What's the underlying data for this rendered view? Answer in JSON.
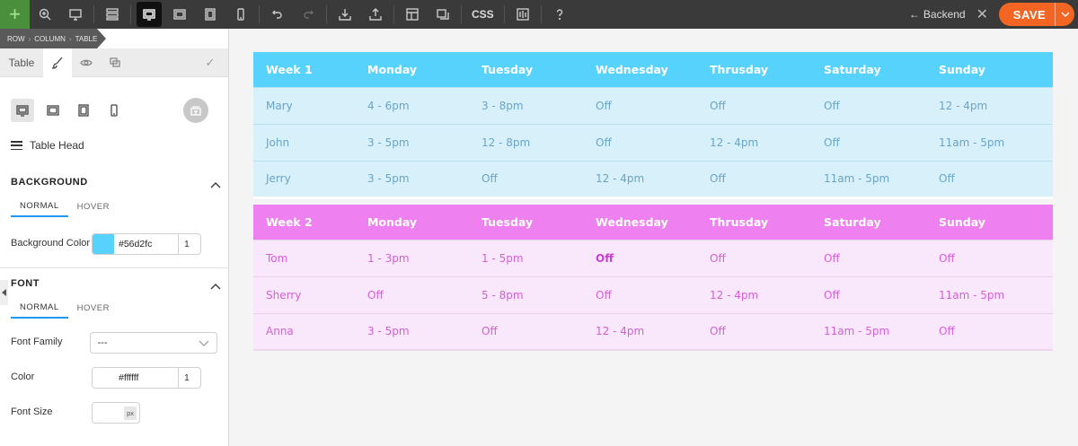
{
  "toolbar": {
    "css_label": "CSS",
    "backend_label": "Backend",
    "save_label": "SAVE"
  },
  "breadcrumb": [
    "ROW",
    "COLUMN",
    "TABLE"
  ],
  "panel": {
    "tabs": {
      "table_label": "Table"
    },
    "element_label": "Table Head",
    "background": {
      "title": "BACKGROUND",
      "tabs": [
        "NORMAL",
        "HOVER"
      ],
      "color_label": "Background Color",
      "color_hex": "#56d2fc",
      "color_alpha": "1"
    },
    "font": {
      "title": "FONT",
      "tabs": [
        "NORMAL",
        "HOVER"
      ],
      "family_label": "Font Family",
      "family_value": "---",
      "color_label": "Color",
      "color_hex": "#ffffff",
      "color_alpha": "1",
      "size_label": "Font Size",
      "size_unit": "px"
    }
  },
  "tables": [
    {
      "header": [
        "Week 1",
        "Monday",
        "Tuesday",
        "Wednesday",
        "Thrusday",
        "Saturday",
        "Sunday"
      ],
      "rows": [
        [
          "Mary",
          "4 - 6pm",
          "3 - 8pm",
          "Off",
          "Off",
          "Off",
          "12 - 4pm"
        ],
        [
          "John",
          "3 - 5pm",
          "12 - 8pm",
          "Off",
          "12 - 4pm",
          "Off",
          "11am - 5pm"
        ],
        [
          "Jerry",
          "3 - 5pm",
          "Off",
          "12 - 4pm",
          "Off",
          "11am - 5pm",
          "Off"
        ]
      ]
    },
    {
      "header": [
        "Week 2",
        "Monday",
        "Tuesday",
        "Wednesday",
        "Thrusday",
        "Saturday",
        "Sunday"
      ],
      "rows": [
        [
          "Tom",
          "1 - 3pm",
          "1 - 5pm",
          "Off",
          "Off",
          "Off",
          "Off"
        ],
        [
          "Sherry",
          "Off",
          "5 - 8pm",
          "Off",
          "12 - 4pm",
          "Off",
          "11am - 5pm"
        ],
        [
          "Anna",
          "3 - 5pm",
          "Off",
          "12 - 4pm",
          "Off",
          "11am - 5pm",
          "Off"
        ]
      ]
    }
  ],
  "colors": {
    "week1_header": "#56d2fc",
    "week1_body": "#d7f0fa",
    "week2_header": "#ee80f0",
    "week2_body": "#f9e7fb",
    "save": "#f26522",
    "add": "#4a8f3b"
  }
}
